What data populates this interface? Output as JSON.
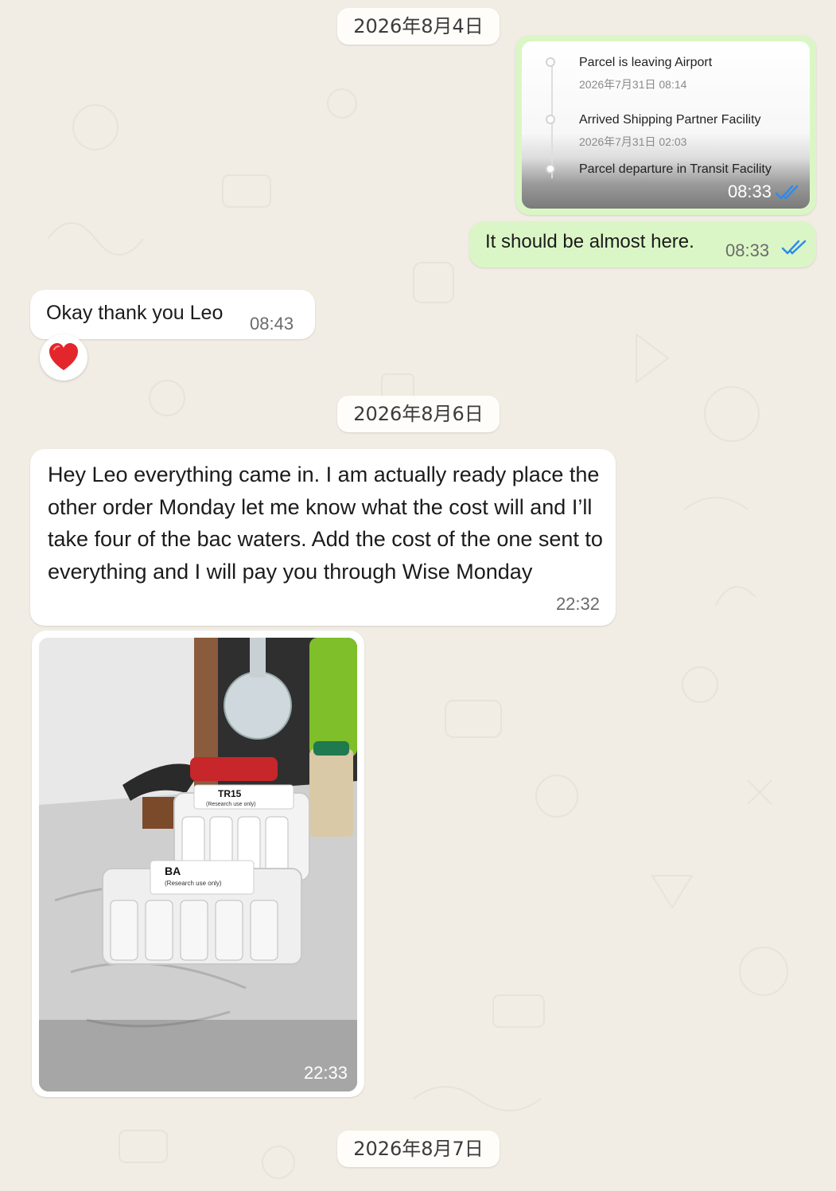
{
  "dates": {
    "first": "2026年8月4日",
    "second": "2026年8月6日",
    "third": "2026年8月7日"
  },
  "tracking": {
    "events": [
      {
        "title": "Parcel is leaving Airport",
        "time": "2026年7月31日 08:14"
      },
      {
        "title": "Arrived Shipping Partner Facility",
        "time": "2026年7月31日 02:03"
      },
      {
        "title": "Parcel departure in Transit Facility",
        "time": ""
      }
    ],
    "sent_time": "08:33"
  },
  "messages": {
    "almost_here": {
      "text": "It should be almost here.",
      "time": "08:33"
    },
    "okay": {
      "text": "Okay thank you Leo",
      "time": "08:43"
    },
    "long": {
      "text": "Hey Leo everything came in. I am actually ready place the other order Monday let me know what the cost will and I’ll take four of the bac waters. Add the cost of the one sent to everything and I will pay you through Wise Monday",
      "time": "22:32"
    },
    "photo": {
      "time": "22:33",
      "labels": {
        "box1_title": "TR15",
        "box1_sub": "(Research use only)",
        "box2_title": "BA",
        "box2_sub": "(Research use only)"
      }
    }
  },
  "icons": {
    "read_ticks": "double-check-icon",
    "reaction": "heart-icon"
  },
  "colors": {
    "outgoing_bubble": "#dbf6c6",
    "incoming_bubble": "#ffffff",
    "read_tick": "#2f8bea",
    "background": "#f1ede4"
  }
}
